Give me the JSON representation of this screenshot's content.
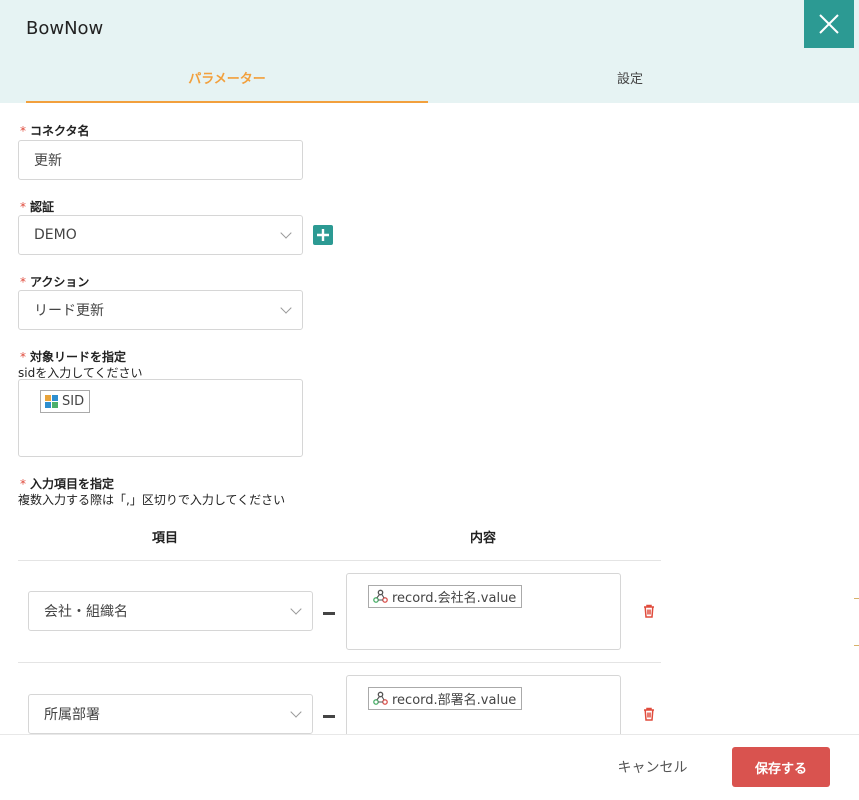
{
  "dialog": {
    "title": "BowNow"
  },
  "tabs": [
    {
      "label": "パラメーター"
    },
    {
      "label": "設定"
    }
  ],
  "form": {
    "connector_name": {
      "label": "コネクタ名",
      "required": "*",
      "value": "更新"
    },
    "auth": {
      "label": "認証",
      "required": "*",
      "value": "DEMO"
    },
    "action": {
      "label": "アクション",
      "required": "*",
      "value": "リード更新"
    },
    "target_lead": {
      "label": "対象リードを指定",
      "required": "*",
      "hint": "sidを入力してください",
      "chip": "SID"
    },
    "input_items": {
      "label": "入力項目を指定",
      "required": "*",
      "hint": "複数入力する際は「,」区切りで入力してください",
      "columns": {
        "item": "項目",
        "content": "内容"
      },
      "rows": [
        {
          "item": "会社・組織名",
          "content": "record.会社名.value"
        },
        {
          "item": "所属部署",
          "content": "record.部署名.value"
        }
      ]
    }
  },
  "footer": {
    "cancel": "キャンセル",
    "save": "保存する"
  },
  "colors": {
    "accent_teal": "#2c9a93",
    "tab_orange": "#f2a03d",
    "save_red": "#d9534f",
    "header_bg": "#e6f3f3"
  },
  "icons": {
    "close": "close-icon",
    "add": "plus-icon",
    "field": "field-grid-icon",
    "webhook": "webhook-icon",
    "delete": "trash-icon"
  }
}
